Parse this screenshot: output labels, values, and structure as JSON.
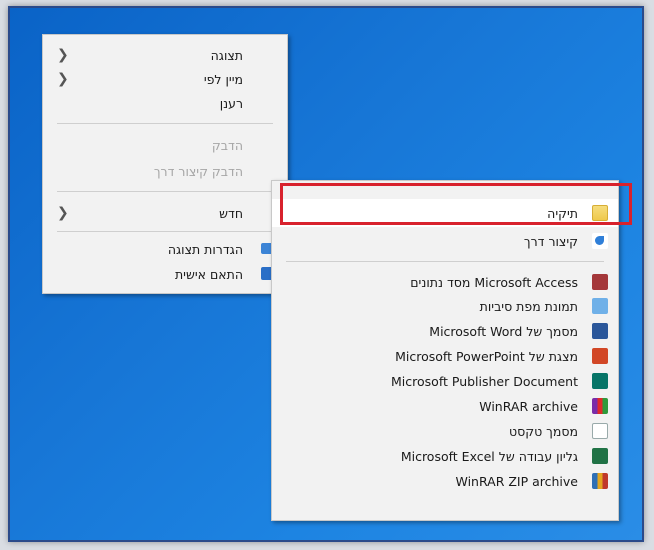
{
  "context_menu": {
    "items": [
      {
        "label": "תצוגה",
        "has_submenu": true
      },
      {
        "label": "מיין לפי",
        "has_submenu": true
      },
      {
        "label": "רענן"
      },
      {
        "label": "הדבק",
        "disabled": true
      },
      {
        "label": "הדבק קיצור דרך",
        "disabled": true
      },
      {
        "label": "חדש",
        "has_submenu": true
      },
      {
        "label": "הגדרות תצוגה",
        "icon": "display-settings-icon"
      },
      {
        "label": "התאם אישית",
        "icon": "personalize-icon"
      }
    ]
  },
  "new_submenu": {
    "items": [
      {
        "label": "תיקיה",
        "icon": "folder-icon"
      },
      {
        "label": "קיצור דרך",
        "icon": "shortcut-icon"
      },
      {
        "label": "Microsoft Access מסד נתונים",
        "icon": "access-icon"
      },
      {
        "label": "תמונת מפת סיביות",
        "icon": "bitmap-icon"
      },
      {
        "label": "מסמך של Microsoft Word",
        "icon": "word-icon"
      },
      {
        "label": "מצגת של Microsoft PowerPoint",
        "icon": "powerpoint-icon"
      },
      {
        "label": "Microsoft Publisher Document",
        "icon": "publisher-icon"
      },
      {
        "label": "WinRAR archive",
        "icon": "winrar-icon"
      },
      {
        "label": "מסמך טקסט",
        "icon": "text-document-icon"
      },
      {
        "label": "גליון עבודה של Microsoft Excel",
        "icon": "excel-icon"
      },
      {
        "label": "WinRAR ZIP archive",
        "icon": "winrar-zip-icon"
      }
    ]
  },
  "colors": {
    "desktop": "#1776d6",
    "menu_bg": "#f2f2f2",
    "highlight_border": "#d8222d"
  }
}
